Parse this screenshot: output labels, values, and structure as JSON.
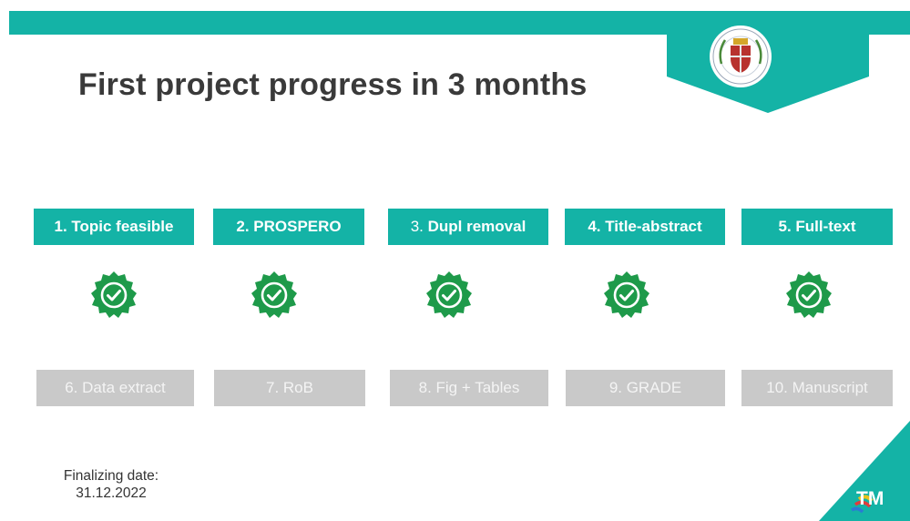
{
  "slide": {
    "title": "First project progress in 3 months",
    "completed_steps": [
      {
        "label": "1. Topic feasible",
        "status": "done"
      },
      {
        "label": "2. PROSPERO",
        "status": "done"
      },
      {
        "number": "3.",
        "label": "Dupl removal",
        "status": "done"
      },
      {
        "label": "4. Title-abstract",
        "status": "done"
      },
      {
        "label": "5. Full-text",
        "status": "done"
      }
    ],
    "pending_steps": [
      {
        "label": "6. Data extract",
        "status": "pending"
      },
      {
        "label": "7. RoB",
        "status": "pending"
      },
      {
        "label": "8. Fig + Tables",
        "status": "pending"
      },
      {
        "label": "9. GRADE",
        "status": "pending"
      },
      {
        "label": "10. Manuscript",
        "status": "pending"
      }
    ],
    "finalizing": {
      "label": "Finalizing date:",
      "date": "31.12.2022"
    },
    "logo_text": "TM",
    "icons": {
      "status": "check-badge-icon",
      "emblem": "university-emblem-icon"
    },
    "colors": {
      "accent": "#14b3a6",
      "done_badge": "#1e9a4a",
      "pending": "#c9c9c9"
    }
  }
}
